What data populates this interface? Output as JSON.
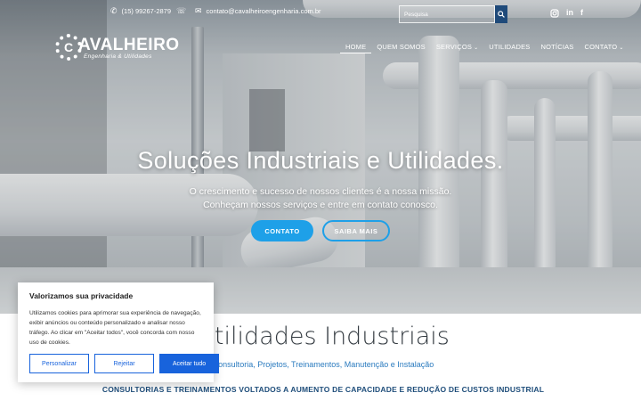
{
  "topbar": {
    "phone": "(15) 99267-2879",
    "phone_icon": "phone-icon",
    "whatsapp_icon": "whatsapp-icon",
    "email": "contato@cavalheiroengenharia.com.br",
    "email_icon": "envelope-icon",
    "search_placeholder": "Pesquisa",
    "search_icon": "search-icon",
    "socials": [
      "instagram-icon",
      "linkedin-icon",
      "facebook-icon"
    ]
  },
  "logo": {
    "name": "AVALHEIRO",
    "tagline": "Engenharia & Utilidades"
  },
  "nav": {
    "items": [
      {
        "label": "HOME",
        "active": true
      },
      {
        "label": "QUEM SOMOS"
      },
      {
        "label": "SERVIÇOS",
        "dropdown": true
      },
      {
        "label": "UTILIDADES"
      },
      {
        "label": "NOTÍCIAS"
      },
      {
        "label": "CONTATO",
        "dropdown": true
      }
    ]
  },
  "hero": {
    "title": "Soluções Industriais e Utilidades.",
    "subtitle_line1": "O crescimento e sucesso de nossos clientes é a nossa missão.",
    "subtitle_line2": "Conheçam nossos serviços e entre em contato conosco.",
    "btn_primary": "CONTATO",
    "btn_secondary": "SAIBA MAIS"
  },
  "section": {
    "title": "Utilidades Industriais",
    "subtitle": "Consultoria, Projetos, Treinamentos, Manutenção e Instalação",
    "banner": "CONSULTORIAS E TREINAMENTOS VOLTADOS A AUMENTO DE CAPACIDADE E REDUÇÃO DE CUSTOS INDUSTRIAL"
  },
  "cookie": {
    "title": "Valorizamos sua privacidade",
    "text": "Utilizamos cookies para aprimorar sua experiência de navegação, exibir anúncios ou conteúdo personalizado e analisar nosso tráfego. Ao clicar em \"Aceitar todos\", você concorda com nosso uso de cookies.",
    "btn_customize": "Personalizar",
    "btn_reject": "Rejeitar",
    "btn_accept": "Aceitar tudo"
  },
  "colors": {
    "accent": "#1ea0e8",
    "cookie_blue": "#1863dc",
    "banner_text": "#1e4d7a",
    "sub_text": "#2b7bbf"
  }
}
